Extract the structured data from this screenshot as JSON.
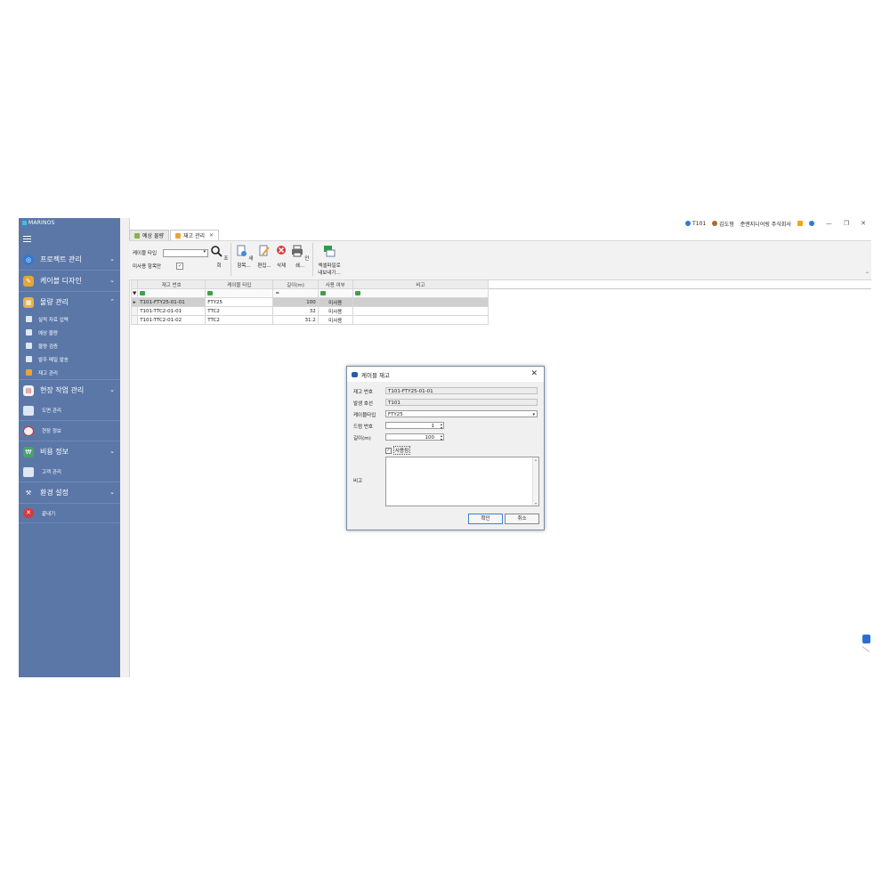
{
  "app": {
    "name": "MARINOS"
  },
  "sidebar": {
    "sections": [
      {
        "label": "프로젝트 관리",
        "icon": "compass-icon",
        "color": "#2f7ad6",
        "expanded": false
      },
      {
        "label": "케이블 디자인",
        "icon": "design-icon",
        "color": "#e3a63a",
        "expanded": false
      },
      {
        "label": "물량 관리",
        "icon": "boxes-icon",
        "color": "#e7b245",
        "expanded": true,
        "items": [
          "실적 자료 입력",
          "예상 물량",
          "물량 검증",
          "발주 메일 발송",
          "재고 관리"
        ]
      },
      {
        "label": "현장 작업 관리",
        "icon": "calendar-icon",
        "color": "#f4f4f4",
        "expanded": false,
        "items": [
          "도면 관리",
          "현장 정보"
        ]
      },
      {
        "label": "비용 정보",
        "icon": "money-icon",
        "color": "#4aa36b",
        "expanded": false,
        "items": [
          "고객 관리"
        ]
      },
      {
        "label": "환경 설정",
        "icon": "tools-icon",
        "color": "#9aa8c0",
        "expanded": false
      },
      {
        "label": "끝내기",
        "icon": "exit-icon",
        "color": "#d63b3b"
      }
    ]
  },
  "tabs": [
    {
      "label": "예상 물량",
      "active": false
    },
    {
      "label": "재고 관리",
      "active": true
    }
  ],
  "status": {
    "project": "T101",
    "user": "김도형",
    "company": "준엔지니어링 주식회사"
  },
  "ribbon": {
    "cable_type_label": "케이블 타입",
    "unused_only_label": "미사용 항목만",
    "unused_only_checked": true,
    "search_label": "조회",
    "new_label": "새 항목...",
    "edit_label": "편집...",
    "delete_label": "삭제",
    "print_label": "인쇄...",
    "export_label_1": "엑셀파일로",
    "export_label_2": "내보내기..."
  },
  "grid": {
    "columns": [
      "재고 번호",
      "케이블 타입",
      "길이(m)",
      "사용 여부",
      "비고"
    ],
    "filter_len": "=",
    "rows": [
      {
        "id": "T101-FTY25-01-01",
        "type": "FTY25",
        "length": "100",
        "used": "미사용",
        "note": ""
      },
      {
        "id": "T101-TTC2-01-01",
        "type": "TTC2",
        "length": "32",
        "used": "미사용",
        "note": ""
      },
      {
        "id": "T101-TTC2-01-02",
        "type": "TTC2",
        "length": "31.2",
        "used": "미사용",
        "note": ""
      }
    ]
  },
  "dialog": {
    "title": "케이블 재고",
    "stock_no_label": "재고 번호",
    "stock_no": "T101-FTY25-01-01",
    "origin_label": "발생 호선",
    "origin": "T101",
    "cable_type_label": "케이블타입",
    "cable_type": "FTY25",
    "drum_label": "드럼 번호",
    "drum": "1",
    "length_label": "길이(m)",
    "length": "100",
    "used_label": "사용됨",
    "used_checked": true,
    "note_label": "비고",
    "ok_label": "확인",
    "cancel_label": "취소"
  }
}
